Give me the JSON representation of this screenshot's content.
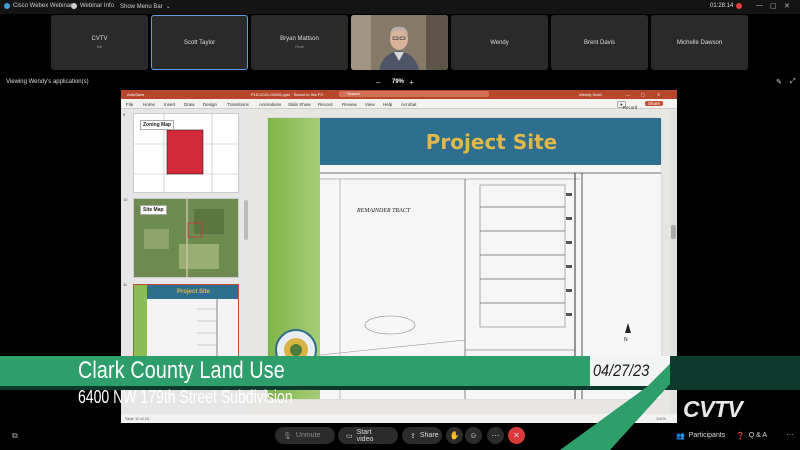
{
  "topbar": {
    "app_name": "Cisco Webex Webinars",
    "webinar_info": "Webinar Info",
    "show_menu_bar": "Show Menu Bar",
    "timer": "01:28:14"
  },
  "participants": [
    {
      "name": "CVTV",
      "role": "Me"
    },
    {
      "name": "Scott Taylor",
      "role": ""
    },
    {
      "name": "Bryan Mattson",
      "role": "Host"
    },
    {
      "name": "Wendy",
      "role": ""
    },
    {
      "name": "Brent Davis",
      "role": ""
    },
    {
      "name": "Michelle Dawson",
      "role": ""
    }
  ],
  "share": {
    "viewing_label": "Viewing Wendy's application(s)",
    "zoom": "79%",
    "zoom_minus": "–",
    "zoom_plus": "+"
  },
  "ppt": {
    "title_left": "AutoSave",
    "file_name": "PLD-2021-00046.pptx · Saved to this PC",
    "search": "Search",
    "user": "Wendy Scott",
    "record": "Record",
    "share_btn": "Share",
    "tabs": [
      "File",
      "Home",
      "Insert",
      "Draw",
      "Design",
      "Transitions",
      "Animations",
      "Slide Show",
      "Record",
      "Review",
      "View",
      "Help",
      "Acrobat"
    ],
    "thumbnails": [
      {
        "num": "9",
        "label": "Zoning Map"
      },
      {
        "num": "10",
        "label": "Site Map"
      },
      {
        "num": "11",
        "label": "Project Site"
      }
    ],
    "slide_title": "Project Site",
    "plat_label": "REMAINDER TRACT",
    "status_left": "Slide 11 of 24",
    "status_right": "110%"
  },
  "lower_third": {
    "title": "Clark County Land Use",
    "subtitle": "6400 NW 179th Street Subdivision",
    "date": "04/27/23",
    "logo": "CVTV"
  },
  "toolbar": {
    "unmute": "Unmute",
    "start_video": "Start video",
    "share": "Share",
    "participants": "Participants",
    "qa": "Q & A"
  },
  "colors": {
    "ppt_accent": "#b7472a",
    "slide_header": "#2e6e8e",
    "slide_title_color": "#e2b84a",
    "lower_third_green": "#2e9e6b",
    "end_call": "#d93a3a"
  }
}
